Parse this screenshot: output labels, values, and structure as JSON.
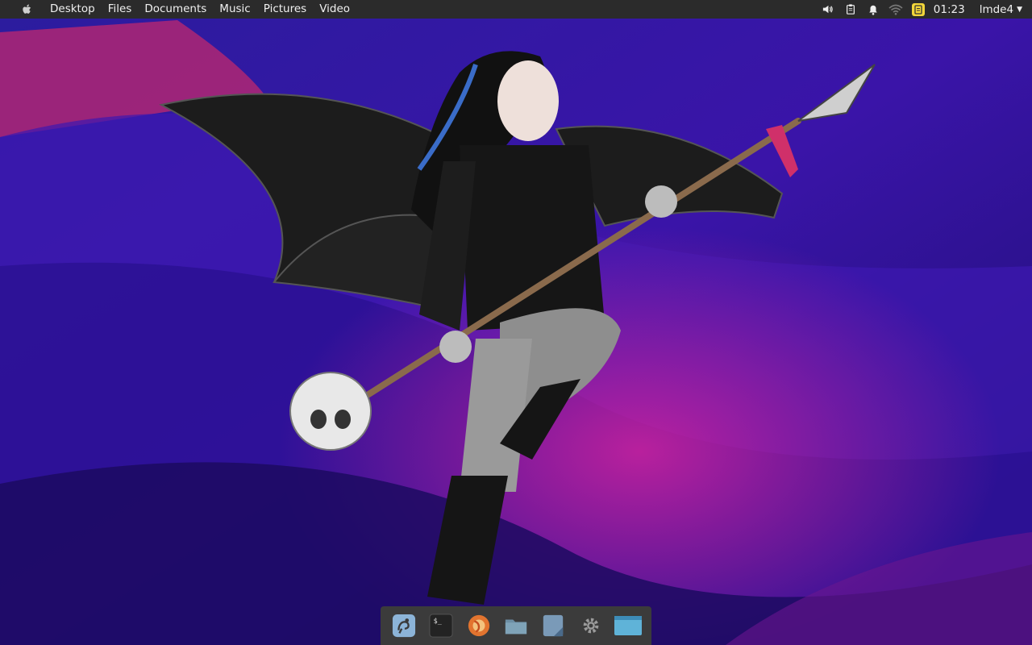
{
  "menubar": {
    "apple_icon": "apple-logo-icon",
    "items": [
      "Desktop",
      "Files",
      "Documents",
      "Music",
      "Pictures",
      "Video"
    ]
  },
  "tray": {
    "icons": [
      "volume-icon",
      "clipboard-icon",
      "bell-icon",
      "wifi-icon",
      "note-icon"
    ],
    "clock": "01:23",
    "user": "lmde4"
  },
  "dock": {
    "items": [
      {
        "name": "gimp",
        "icon": "gimp-icon"
      },
      {
        "name": "terminal",
        "icon": "terminal-icon"
      },
      {
        "name": "firefox",
        "icon": "firefox-icon"
      },
      {
        "name": "files",
        "icon": "folder-icon"
      },
      {
        "name": "text-editor",
        "icon": "document-icon"
      },
      {
        "name": "settings",
        "icon": "gear-icon"
      },
      {
        "name": "window",
        "icon": "window-icon"
      }
    ]
  },
  "colors": {
    "topbar": "#2b2b2b",
    "dock": "#3b3b3b",
    "wallpaper_base": "#3a1a9a",
    "wallpaper_accent": "#b0209a"
  }
}
